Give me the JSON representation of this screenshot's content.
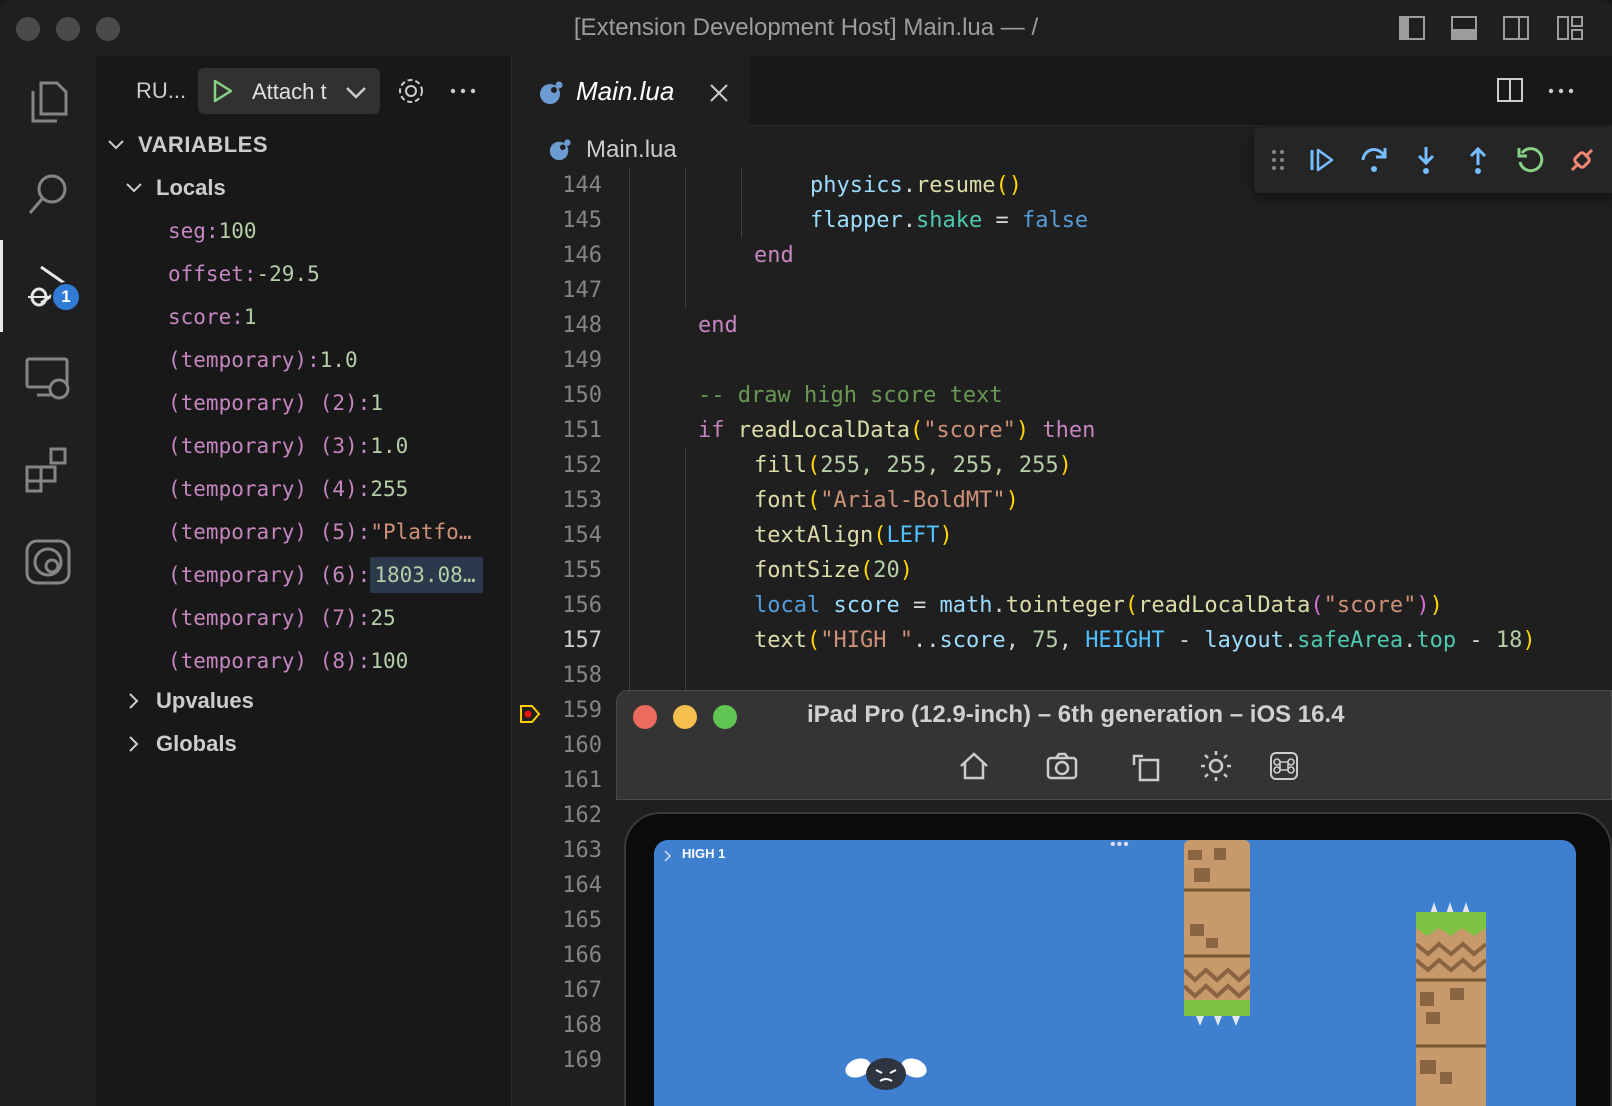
{
  "window": {
    "title": "[Extension Development Host] Main.lua — /"
  },
  "activity_bar": {
    "items": [
      "explorer",
      "search",
      "run-and-debug",
      "remote-explorer",
      "extensions",
      "codea"
    ],
    "debug_badge": "1"
  },
  "sidebar": {
    "title": "RU...",
    "config_label": "Attach t",
    "variables_header": "VARIABLES",
    "locals_header": "Locals",
    "locals": [
      {
        "name": "seg",
        "value": "100",
        "type": "num"
      },
      {
        "name": "offset",
        "value": "-29.5",
        "type": "num"
      },
      {
        "name": "score",
        "value": "1",
        "type": "num"
      },
      {
        "name": "(temporary)",
        "value": "1.0",
        "type": "num"
      },
      {
        "name": "(temporary) (2)",
        "value": "1",
        "type": "num"
      },
      {
        "name": "(temporary) (3)",
        "value": "1.0",
        "type": "num"
      },
      {
        "name": "(temporary) (4)",
        "value": "255",
        "type": "num"
      },
      {
        "name": "(temporary) (5)",
        "value": "\"Platfo…",
        "type": "str"
      },
      {
        "name": "(temporary) (6)",
        "value": "1803.08…",
        "type": "num"
      },
      {
        "name": "(temporary) (7)",
        "value": "25",
        "type": "num"
      },
      {
        "name": "(temporary) (8)",
        "value": "100",
        "type": "num"
      }
    ],
    "upvalues_header": "Upvalues",
    "globals_header": "Globals"
  },
  "editor": {
    "tab_label": "Main.lua",
    "breadcrumb": "Main.lua",
    "current_line": 157,
    "line_numbers": [
      "144",
      "145",
      "146",
      "147",
      "148",
      "149",
      "150",
      "151",
      "152",
      "153",
      "154",
      "155",
      "156",
      "157",
      "158",
      "159",
      "160",
      "161",
      "162",
      "163",
      "164",
      "165",
      "166",
      "167",
      "168",
      "169"
    ],
    "code": {
      "l144": {
        "a": "physics",
        "b": ".",
        "c": "resume",
        "d": "()"
      },
      "l145": {
        "a": "flapper",
        "b": ".",
        "c": "shake",
        "d": " = ",
        "e": "false"
      },
      "l146": "end",
      "l148": "end",
      "l150": "-- draw high score text",
      "l151": {
        "kw": "if",
        "fn": "readLocalData",
        "p1": "(",
        "s": "\"score\"",
        "p2": ")",
        "then": "then"
      },
      "l152": {
        "fn": "fill",
        "args": "255, 255, 255, 255"
      },
      "l153": {
        "fn": "font",
        "s": "\"Arial-BoldMT\""
      },
      "l154": {
        "fn": "textAlign",
        "c": "LEFT"
      },
      "l155": {
        "fn": "fontSize",
        "n": "20"
      },
      "l156": {
        "kw": "local",
        "v": "score",
        "eq": " = ",
        "m": "math",
        "dot": ".",
        "f": "tointeger",
        "f2": "readLocalData",
        "s": "\"score\""
      },
      "l157": {
        "fn": "text",
        "s": "\"HIGH \"",
        "cc": "..",
        "v": "score",
        "n": "75",
        "c": "HEIGHT",
        "v2": "layout",
        "p": "safeArea",
        "p2": "top",
        "n2": "18"
      }
    }
  },
  "simulator": {
    "title": "iPad Pro (12.9-inch) – 6th generation – iOS 16.4",
    "buttons": [
      "home-icon",
      "screenshot-icon",
      "rotate-icon",
      "appearance-icon",
      "command-icon"
    ],
    "game_text": "HIGH 1"
  },
  "colors": {
    "accent": "#2f7bd6",
    "debug_continue": "#75beff",
    "debug_restart": "#89d185",
    "debug_disconnect": "#f48771",
    "current_line": "#4b4b18",
    "game_sky": "#3e7fcf"
  }
}
